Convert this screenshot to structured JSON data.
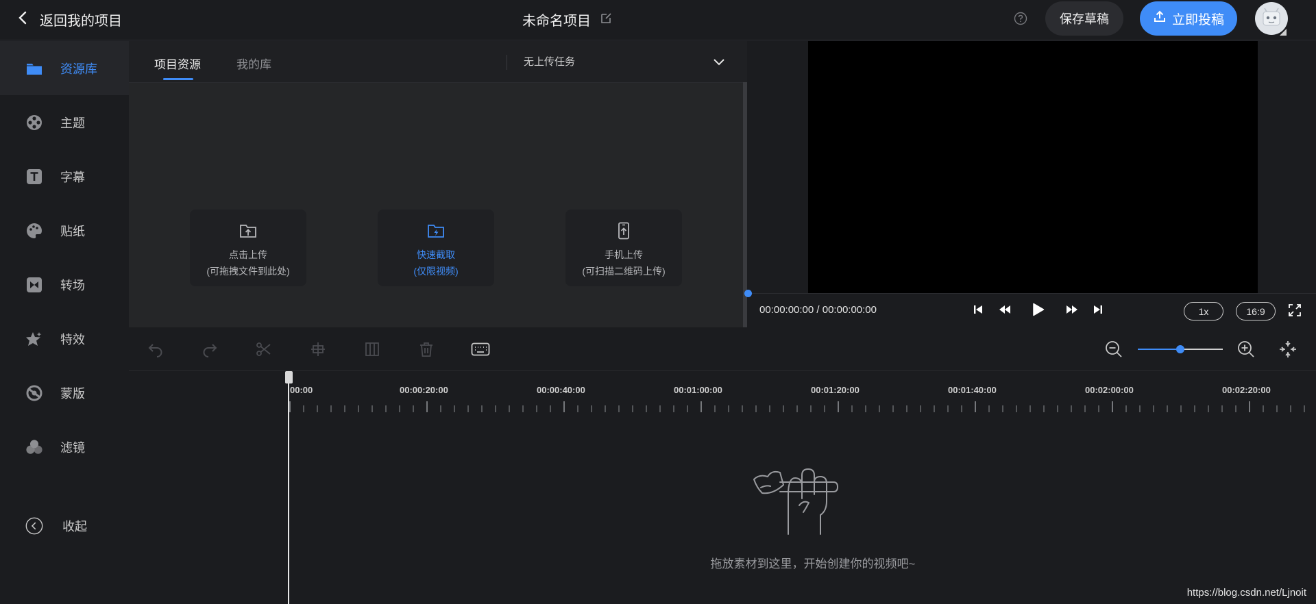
{
  "topbar": {
    "back_label": "返回我的项目",
    "project_title": "未命名项目",
    "save_label": "保存草稿",
    "publish_label": "立即投稿"
  },
  "sidebar": {
    "items": [
      {
        "label": "资源库",
        "icon": "folder-icon"
      },
      {
        "label": "主题",
        "icon": "film-reel-icon"
      },
      {
        "label": "字幕",
        "icon": "text-icon"
      },
      {
        "label": "贴纸",
        "icon": "palette-icon"
      },
      {
        "label": "转场",
        "icon": "transition-icon"
      },
      {
        "label": "特效",
        "icon": "star-icon"
      },
      {
        "label": "蒙版",
        "icon": "mask-icon"
      },
      {
        "label": "滤镜",
        "icon": "filter-icon"
      }
    ],
    "collapse_label": "收起"
  },
  "library": {
    "tabs": [
      {
        "label": "项目资源"
      },
      {
        "label": "我的库"
      }
    ],
    "upload_status": "无上传任务",
    "cards": [
      {
        "line1": "点击上传",
        "line2": "(可拖拽文件到此处)"
      },
      {
        "line1": "快速截取",
        "line2": "(仅限视频)"
      },
      {
        "line1": "手机上传",
        "line2": "(可扫描二维码上传)"
      }
    ]
  },
  "preview": {
    "timecode": "00:00:00:00 / 00:00:00:00",
    "speed": "1x",
    "ratio": "16:9"
  },
  "zoom": {
    "level": 0.5
  },
  "timeline": {
    "ruler_labels": [
      "00:00",
      "00:00:20:00",
      "00:00:40:00",
      "00:01:00:00",
      "00:01:20:00",
      "00:01:40:00",
      "00:02:00:00",
      "00:02:20:00"
    ],
    "empty_text": "拖放素材到这里，开始创建你的视频吧~"
  },
  "watermark": "https://blog.csdn.net/Ljnoit",
  "colors": {
    "accent": "#3f8cf7",
    "background": "#1b1c1f"
  }
}
